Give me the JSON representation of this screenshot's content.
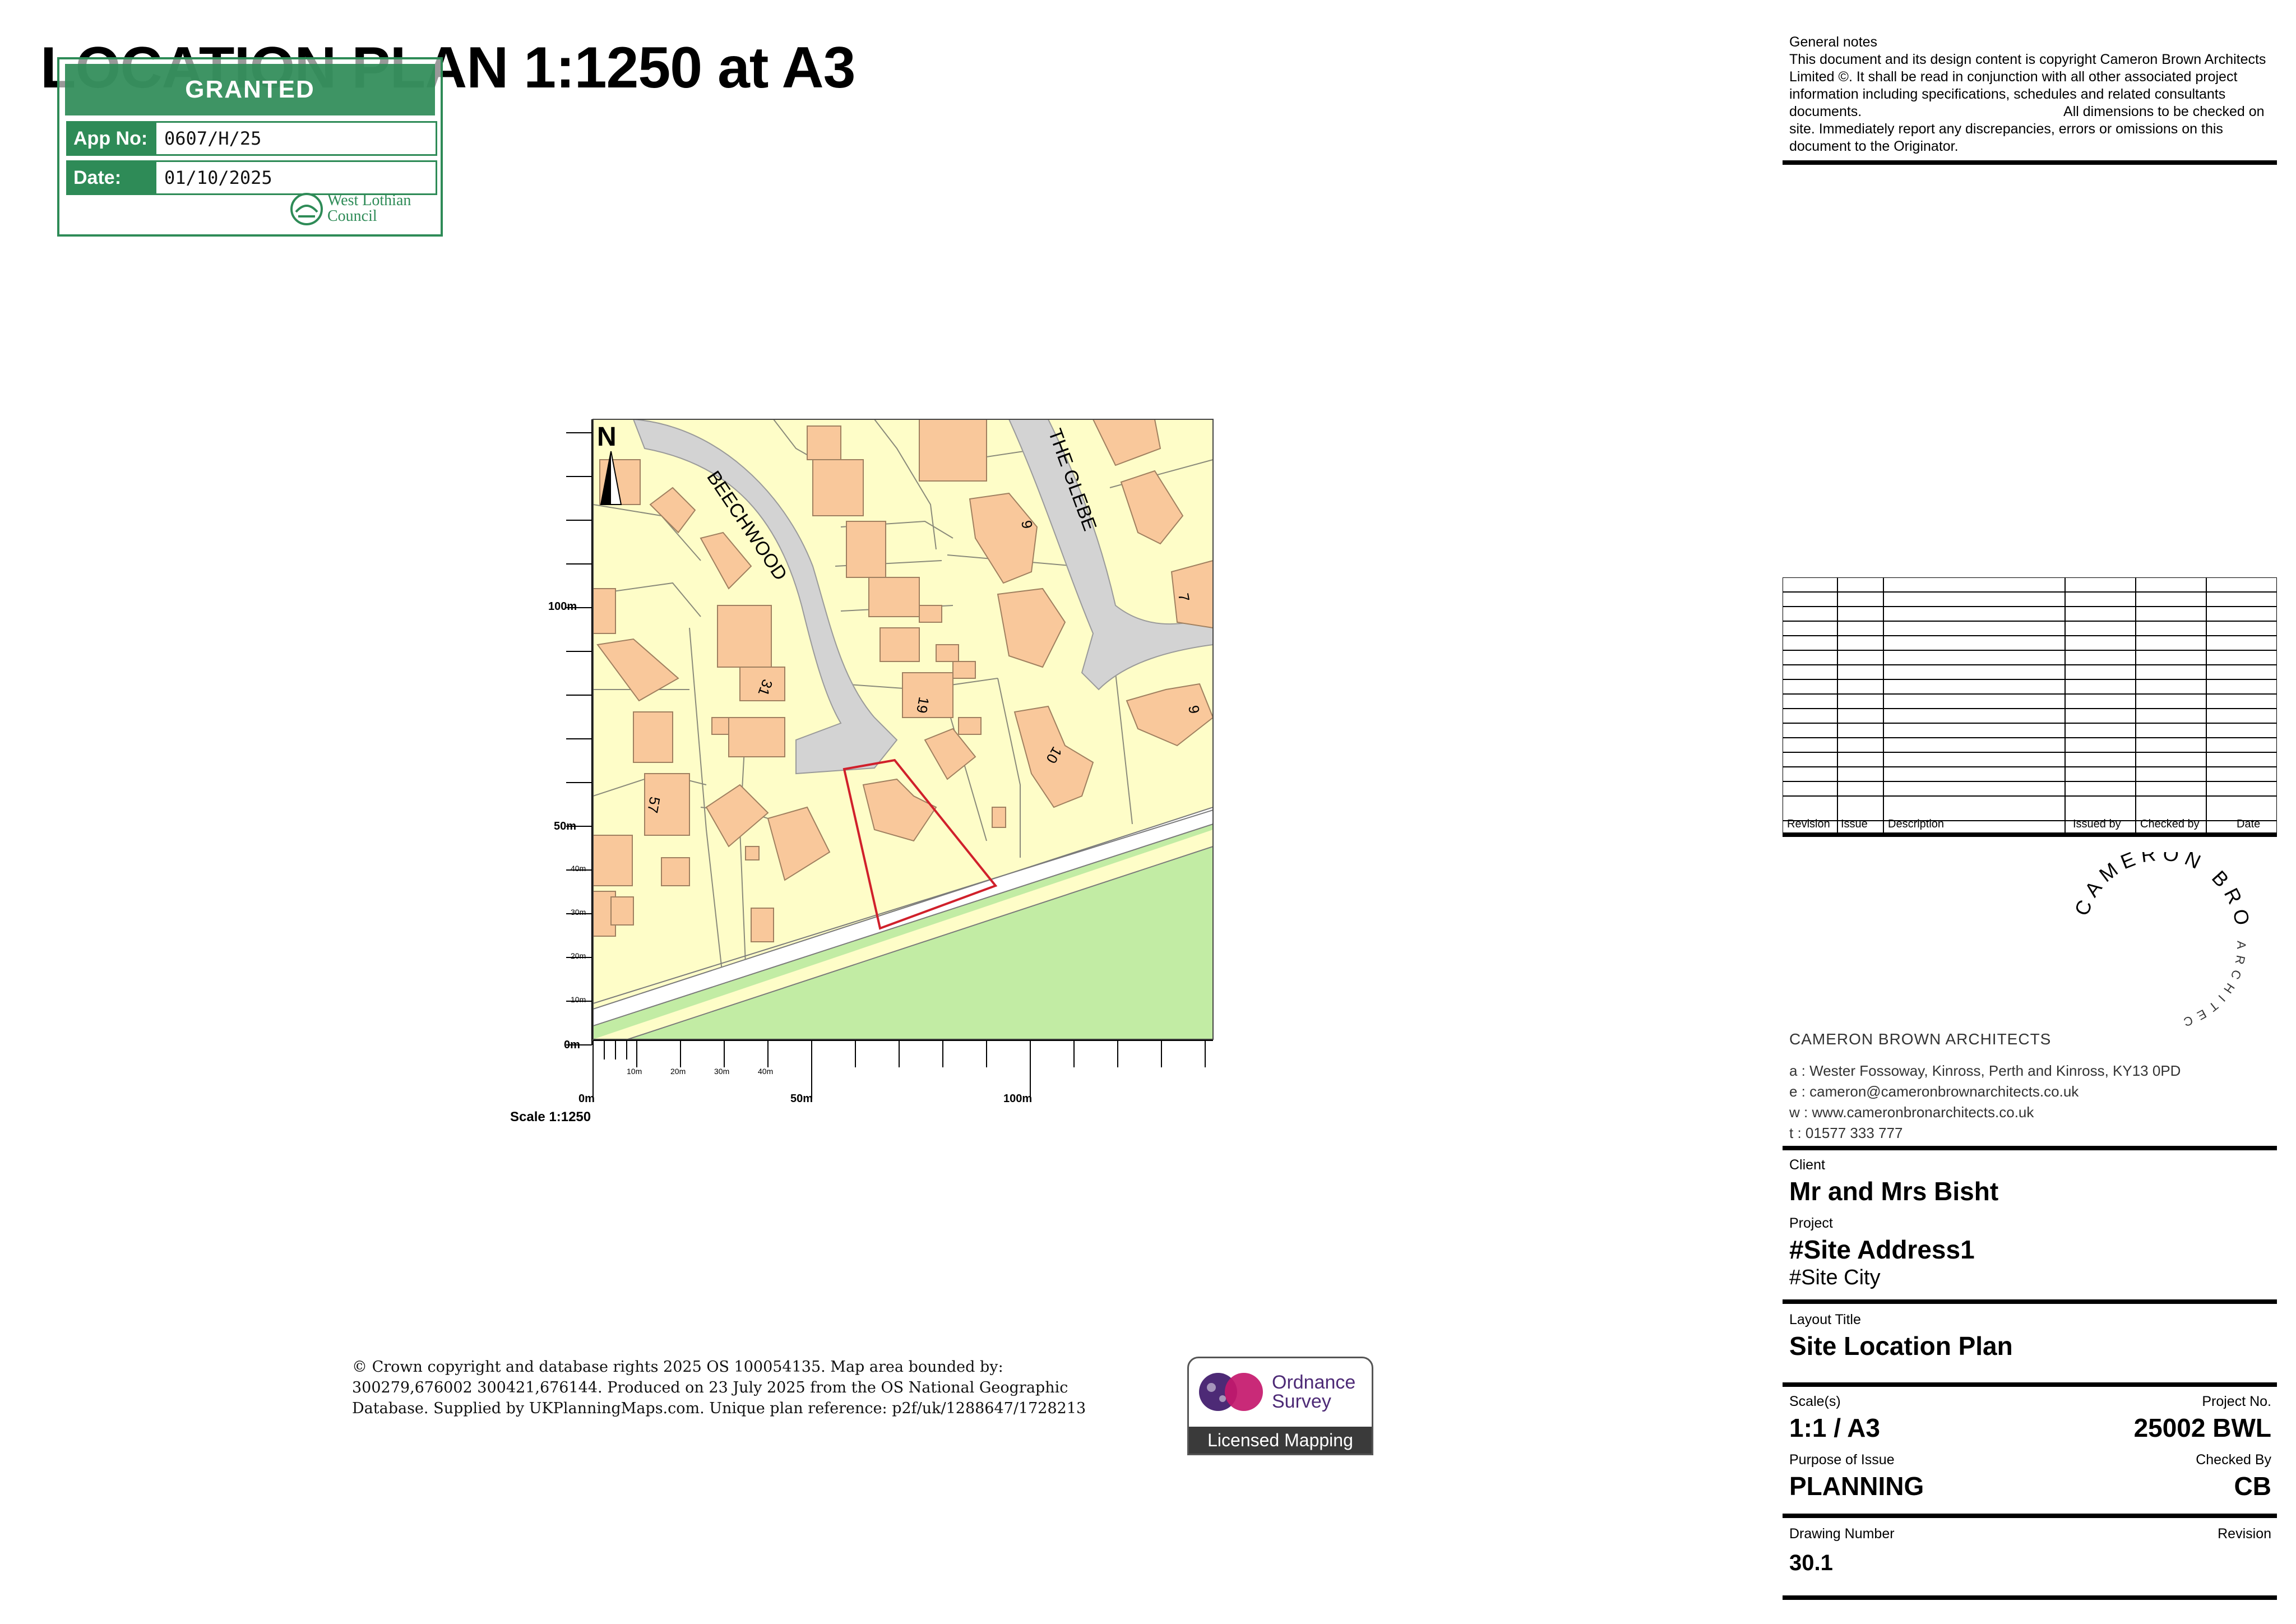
{
  "title": "LOCATION PLAN 1:1250 at A3",
  "stamp": {
    "status": "GRANTED",
    "app_label": "App No:",
    "app_value": "0607/H/25",
    "date_label": "Date:",
    "date_value": "01/10/2025",
    "council_line1": "West Lothian",
    "council_line2": "Council"
  },
  "notes": {
    "heading": "General notes",
    "body": "This document and its design content is copyright Cameron Brown Architects Limited ©. It shall be read in conjunction with all other associated project information including specifications, schedules and related consultants documents.                                                    All dimensions to be checked on site. Immediately report any discrepancies, errors or omissions on this document to the Originator."
  },
  "revision_table": {
    "headers": [
      "Revision",
      "Issue",
      "Description",
      "Issued by",
      "Checked by",
      "Date"
    ]
  },
  "map": {
    "north": "N",
    "streets": [
      "BEECHWOOD",
      "THE GLEBE"
    ],
    "house_numbers": [
      "9",
      "7",
      "31",
      "19",
      "10",
      "9",
      "57"
    ],
    "scale_left": [
      "100m",
      "50m",
      "40m",
      "30m",
      "20m",
      "10m",
      "0m"
    ],
    "scale_bottom": [
      "10m",
      "20m",
      "30m",
      "40m",
      "0m",
      "50m",
      "100m"
    ],
    "scale_label": "Scale 1:1250"
  },
  "logo": {
    "arc_text": "CAMERON BROWN",
    "arc_sub": "ARCHITECTS",
    "company": "CAMERON BROWN ARCHITECTS",
    "address": "a : Wester Fossoway, Kinross, Perth and Kinross, KY13 0PD",
    "email": "e : cameron@cameronbrownarchitects.co.uk",
    "web": "w : www.cameronbronarchitects.co.uk",
    "tel": "t : 01577 333 777"
  },
  "title_block": {
    "client_label": "Client",
    "client": "Mr and Mrs Bisht",
    "project_label": "Project",
    "project": "#Site Address1",
    "project_city": "#Site City",
    "layout_label": "Layout Title",
    "layout": "Site Location Plan",
    "scale_label": "Scale(s)",
    "scale": "1:1 / A3",
    "project_no_label": "Project No.",
    "project_no": "25002 BWL",
    "purpose_label": "Purpose of Issue",
    "purpose": "PLANNING",
    "checked_label": "Checked By",
    "checked": "CB",
    "drawing_label": "Drawing Number",
    "drawing": "30.1",
    "revision_label": "Revision"
  },
  "copyright": "© Crown copyright and database rights 2025 OS 100054135. Map area bounded by: 300279,676002 300421,676144. Produced on 23 July 2025 from the OS National Geographic Database. Supplied by UKPlanningMaps.com. Unique plan reference: p2f/uk/1288647/1728213",
  "os": {
    "line1": "Ordnance",
    "line2": "Survey",
    "licensed": "Licensed Mapping"
  },
  "colors": {
    "stamp_green": "#2e8b57",
    "plot_fill": "#fefdc8",
    "building_fill": "#f9c89b",
    "road_fill": "#d3d3d3",
    "grass_fill": "#c2eca4",
    "site_boundary": "#d0202b"
  }
}
